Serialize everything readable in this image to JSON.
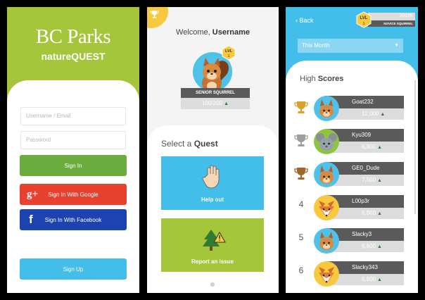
{
  "login": {
    "brand_title": "BC Parks",
    "brand_subtitle": "natureQUEST",
    "username_placeholder": "Username / Email",
    "password_placeholder": "Password",
    "signin_label": "Sign In",
    "google_label": "Sign In With Google",
    "google_icon": "g+",
    "facebook_label": "Sign In With Facebook",
    "facebook_icon": "f",
    "signup_label": "Sign Up",
    "colors": {
      "green": "#a5c63b",
      "signin": "#6bac3f",
      "google": "#e8412f",
      "facebook": "#1d43b1",
      "signup": "#43bdea"
    }
  },
  "home": {
    "welcome_prefix": "Welcome,",
    "username": "Username",
    "level_badge": "LVL",
    "level_number": "1",
    "rank_name": "SENIOR SQUIRREL",
    "xp": "100/200",
    "select_prefix": "Select a",
    "select_word": "Quest",
    "quests": [
      {
        "label": "Help out",
        "icon": "hand-icon",
        "color": "#43bdea"
      },
      {
        "label": "Report an issue",
        "icon": "tree-warning-icon",
        "color": "#a5c63b"
      }
    ]
  },
  "scores": {
    "back_label": "Back",
    "level_badge": "LVL",
    "level_number": "1",
    "mini_xp": "20/100",
    "mini_rank": "NOVICE SQUIRREL",
    "period": "This Month",
    "title_prefix": "High",
    "title_word": "Scores",
    "rows": [
      {
        "rank": "",
        "medal": "gold",
        "name": "Goat232",
        "xp": "12,000",
        "animal": "squirrel"
      },
      {
        "rank": "",
        "medal": "silver",
        "name": "Kyu309",
        "xp": "6,800",
        "animal": "mouse"
      },
      {
        "rank": "",
        "medal": "bronze",
        "name": "GE0_Dude",
        "xp": "7,500",
        "animal": "squirrel"
      },
      {
        "rank": "4",
        "medal": "",
        "name": "L00p3r",
        "xp": "6,800",
        "animal": "fox"
      },
      {
        "rank": "5",
        "medal": "",
        "name": "Slacky3",
        "xp": "6,800",
        "animal": "squirrel"
      },
      {
        "rank": "6",
        "medal": "",
        "name": "Slacky343",
        "xp": "6,800",
        "animal": "fox"
      }
    ]
  }
}
